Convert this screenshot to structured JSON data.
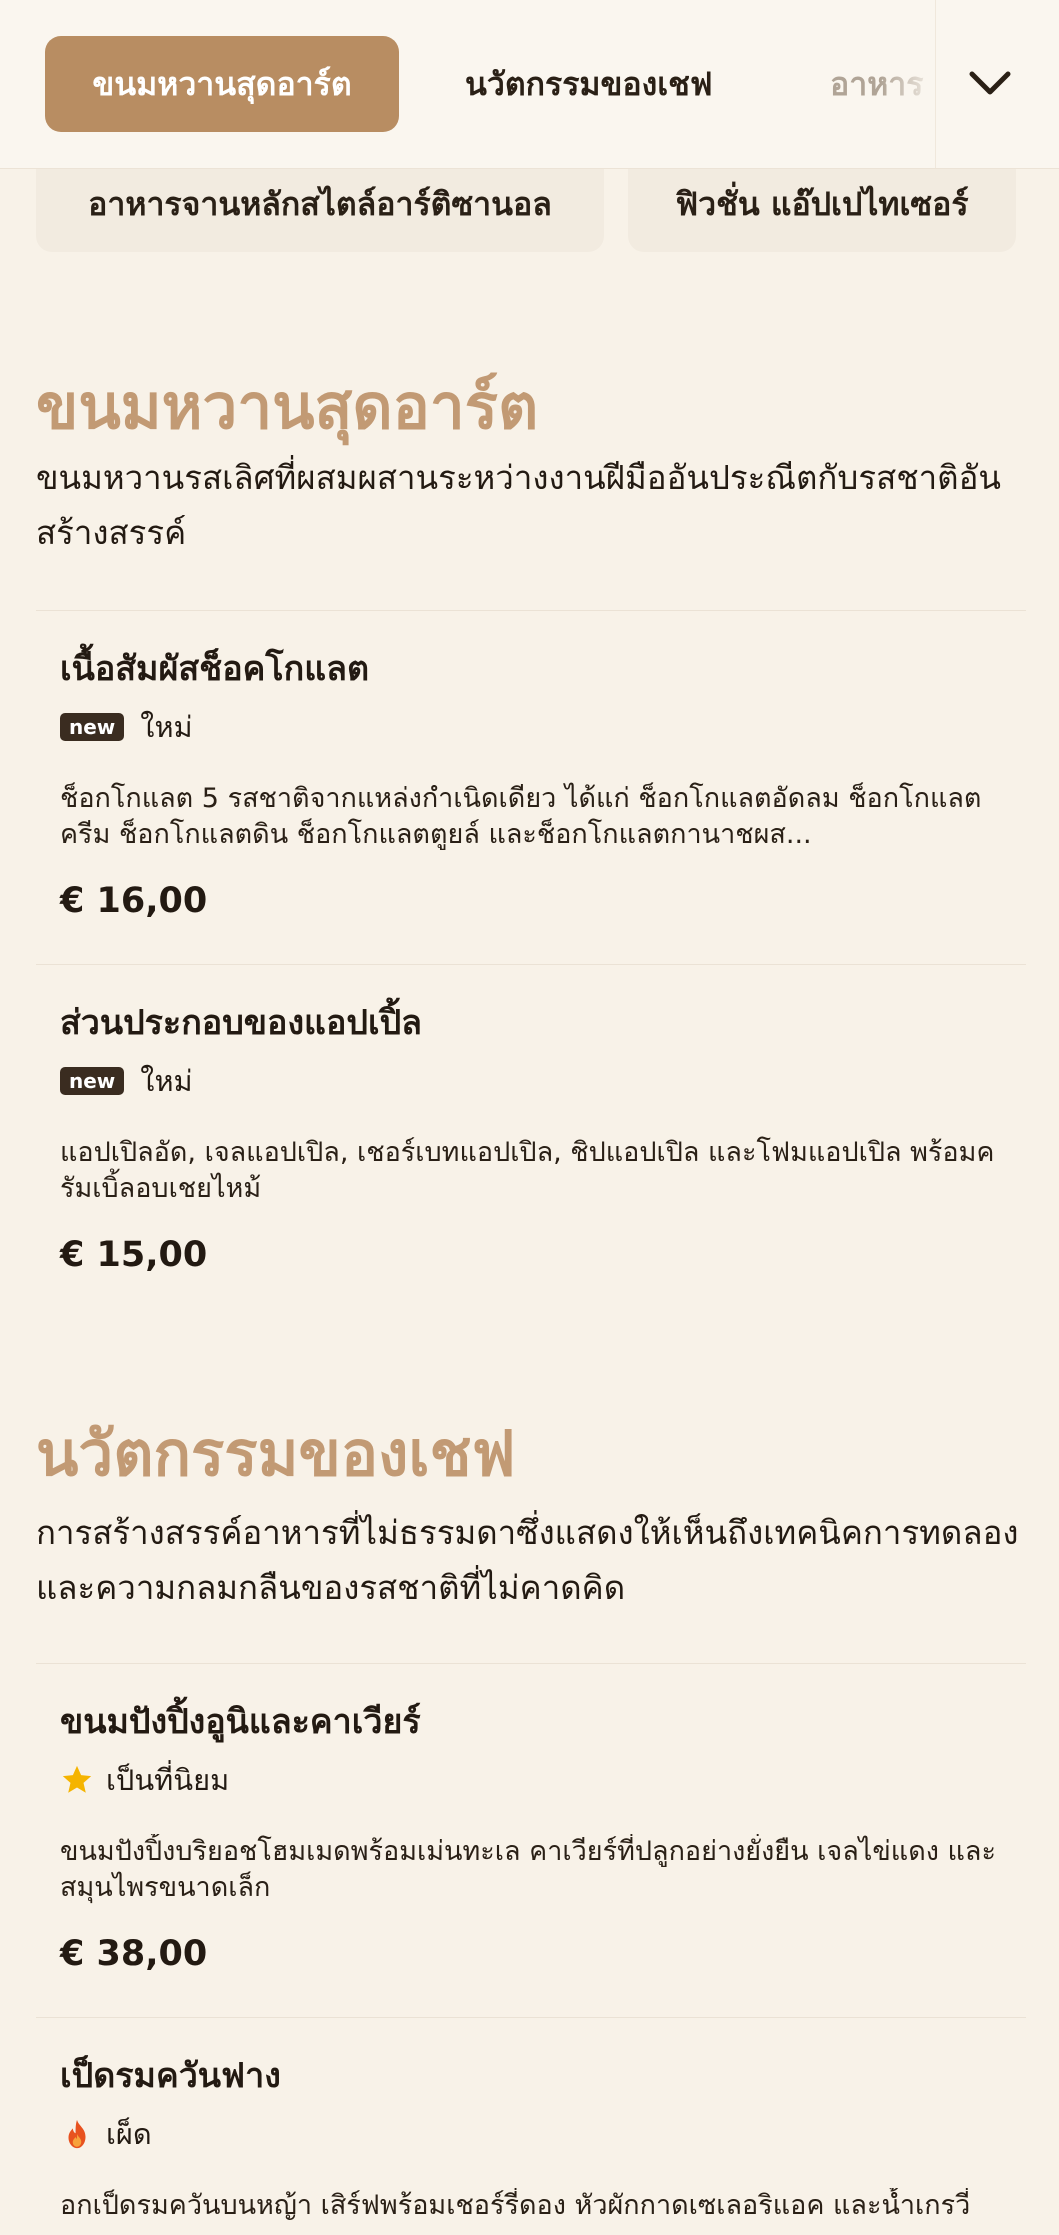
{
  "tabs": [
    {
      "label": "ขนมหวานสุดอาร์ต"
    },
    {
      "label": "นวัตกรรมของเชฟ"
    },
    {
      "label": "อาหาร"
    }
  ],
  "pills": [
    {
      "label": "อาหารจานหลักสไตล์อาร์ติซานอล"
    },
    {
      "label": "ฟิวชั่น แอ๊ปเปไทเซอร์"
    }
  ],
  "sections": [
    {
      "title": "ขนมหวานสุดอาร์ต",
      "description": "ขนมหวานรสเลิศที่ผสมผสานระหว่างงานฝีมืออันประณีตกับรสชาติอันสร้างสรรค์",
      "items": [
        {
          "name": "เนื้อสัมผัสช็อคโกแลต",
          "tag": "new",
          "badge": "ใหม่",
          "description": "ช็อกโกแลต 5 รสชาติจากแหล่งกำเนิดเดียว ได้แก่ ช็อกโกแลตอัดลม ช็อกโกแลตครีม ช็อกโกแลตดิน ช็อกโกแลตตูยล์ และช็อกโกแลตกานาชผส...",
          "price": "€ 16,00"
        },
        {
          "name": "ส่วนประกอบของแอปเปิ้ล",
          "tag": "new",
          "badge": "ใหม่",
          "description": "แอปเปิลอัด, เจลแอปเปิล, เชอร์เบทแอปเปิล, ชิปแอปเปิล และโฟมแอปเปิล พร้อมครัมเบิ้ลอบเชยไหม้",
          "price": "€ 15,00"
        }
      ]
    },
    {
      "title": "นวัตกรรมของเชฟ",
      "description": "การสร้างสรรค์อาหารที่ไม่ธรรมดาซึ่งแสดงให้เห็นถึงเทคนิคการทดลองและความกลมกลืนของรสชาติที่ไม่คาดคิด",
      "items": [
        {
          "name": "ขนมปังปิ้งอูนิและคาเวียร์",
          "icon": "star-icon",
          "badge": "เป็นที่นิยม",
          "description": "ขนมปังปิ้งบริยอชโฮมเมดพร้อมเม่นทะเล คาเวียร์ที่ปลูกอย่างยั่งยืน เจลไข่แดง และสมุนไพรขนาดเล็ก",
          "price": "€ 38,00"
        },
        {
          "name": "เป็ดรมควันฟาง",
          "icon": "flame-icon",
          "badge": "เผ็ด",
          "description": "อกเป็ดรมควันบนหญ้า เสิร์ฟพร้อมเชอร์รี่ดอง หัวผักกาดเซเลอริแอค และน้ำเกรวี่",
          "price": ""
        }
      ]
    }
  ],
  "colors": {
    "accent": "#b88d62",
    "section_title": "#c29a74",
    "background": "#f8f2e8",
    "star": "#f5b400",
    "flame": "#e8521f"
  }
}
